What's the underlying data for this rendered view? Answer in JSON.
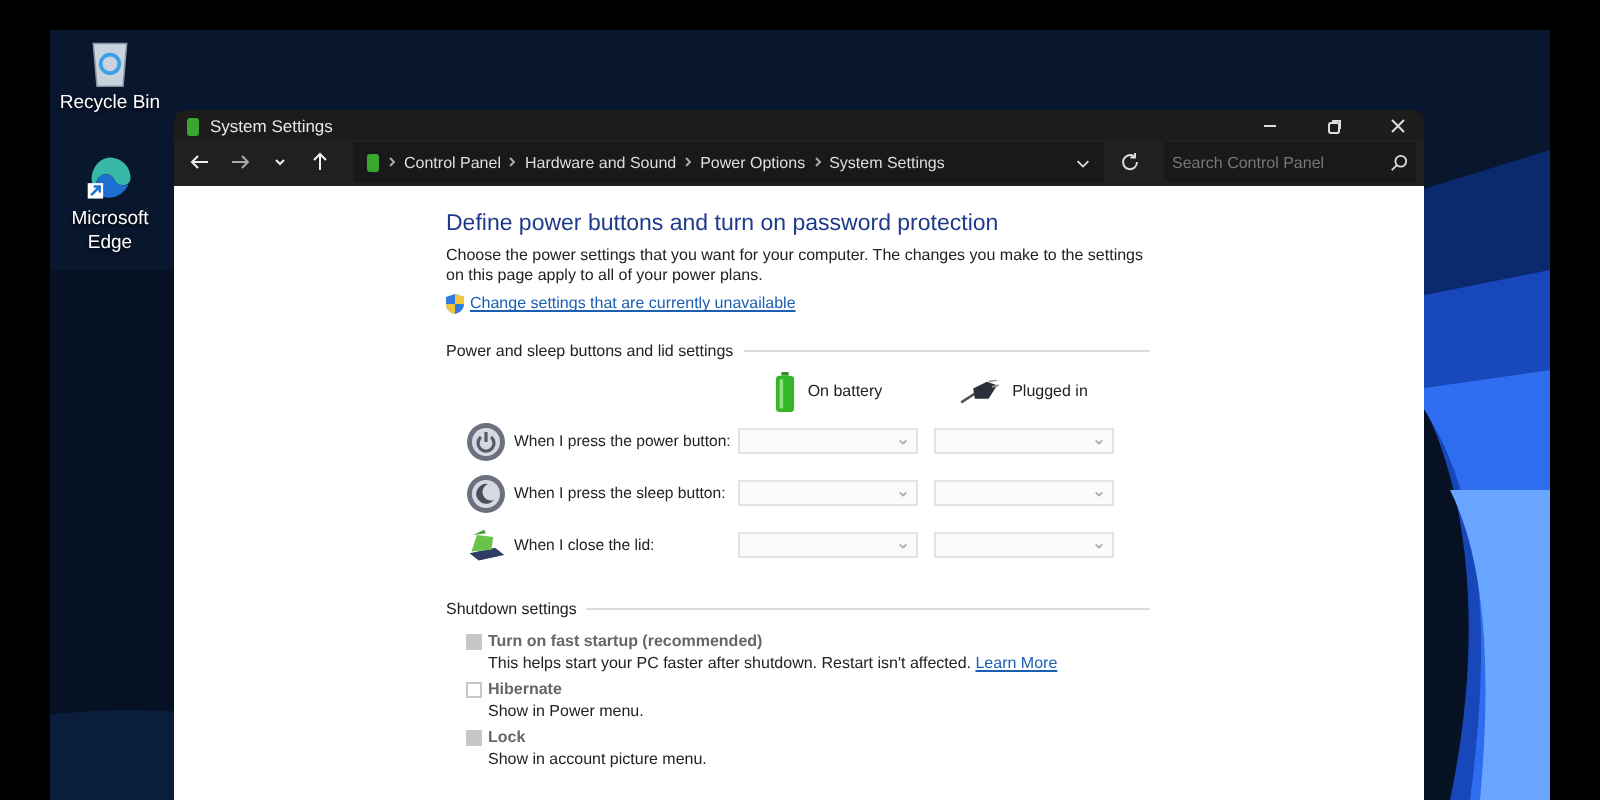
{
  "desktop_icons": [
    {
      "label": "Recycle Bin",
      "kind": "recycle-bin"
    },
    {
      "label": "Microsoft Edge",
      "kind": "edge"
    }
  ],
  "window": {
    "title": "System Settings"
  },
  "address_bar": {
    "breadcrumbs": [
      "Control Panel",
      "Hardware and Sound",
      "Power Options",
      "System Settings"
    ],
    "search": {
      "placeholder": "Search Control Panel"
    }
  },
  "content": {
    "heading": "Define power buttons and turn on password protection",
    "description": "Choose the power settings that you want for your computer. The changes you make to the settings on this page apply to all of your power plans.",
    "admin_link": "Change settings that are currently unavailable",
    "buttons_section": {
      "title": "Power and sleep buttons and lid settings",
      "columns": [
        {
          "label": "On battery",
          "kind": "battery"
        },
        {
          "label": "Plugged in",
          "kind": "plug"
        }
      ],
      "rows": [
        {
          "label": "When I press the power button:",
          "kind": "power",
          "disabled": true
        },
        {
          "label": "When I press the sleep button:",
          "kind": "sleep",
          "disabled": true
        },
        {
          "label": "When I close the lid:",
          "kind": "lid",
          "disabled": true
        }
      ]
    },
    "shutdown_section": {
      "title": "Shutdown settings",
      "options": [
        {
          "label": "Turn on fast startup (recommended)",
          "description": "This helps start your PC faster after shutdown. Restart isn't affected.",
          "link": "Learn More",
          "checked": true,
          "disabled": true
        },
        {
          "label": "Hibernate",
          "description": "Show in Power menu.",
          "checked": false,
          "disabled": true
        },
        {
          "label": "Lock",
          "description": "Show in account picture menu.",
          "checked": true,
          "disabled": true
        }
      ]
    }
  }
}
